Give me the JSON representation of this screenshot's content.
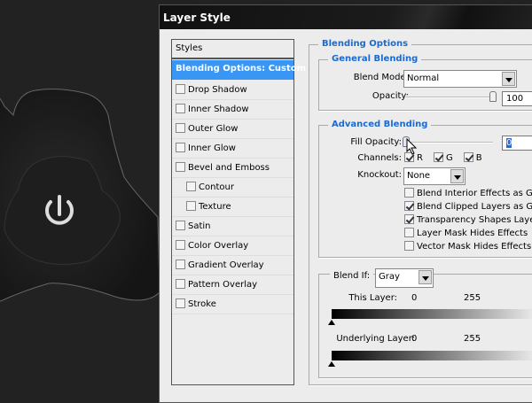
{
  "dialog": {
    "title": "Layer Style"
  },
  "list": {
    "header": "Styles",
    "selected": "Blending Options: Custom",
    "items": [
      {
        "label": "Drop Shadow",
        "checked": false
      },
      {
        "label": "Inner Shadow",
        "checked": false
      },
      {
        "label": "Outer Glow",
        "checked": false
      },
      {
        "label": "Inner Glow",
        "checked": false
      },
      {
        "label": "Bevel and Emboss",
        "checked": false
      },
      {
        "label": "Contour",
        "checked": false
      },
      {
        "label": "Texture",
        "checked": false
      },
      {
        "label": "Satin",
        "checked": false
      },
      {
        "label": "Color Overlay",
        "checked": false
      },
      {
        "label": "Gradient Overlay",
        "checked": false
      },
      {
        "label": "Pattern Overlay",
        "checked": false
      },
      {
        "label": "Stroke",
        "checked": false
      }
    ]
  },
  "blending": {
    "title": "Blending Options",
    "general": {
      "title": "General Blending",
      "blend_mode_label": "Blend Mode:",
      "blend_mode": "Normal",
      "opacity_label": "Opacity:",
      "opacity": "100",
      "opacity_pct": 100
    },
    "advanced": {
      "title": "Advanced Blending",
      "fill_label": "Fill Opacity:",
      "fill": "0",
      "fill_pct": 0,
      "channels_label": "Channels:",
      "channels": [
        "R",
        "G",
        "B"
      ],
      "knockout_label": "Knockout:",
      "knockout": "None",
      "options": [
        {
          "label": "Blend Interior Effects as Group",
          "checked": false
        },
        {
          "label": "Blend Clipped Layers as Group",
          "checked": true
        },
        {
          "label": "Transparency Shapes Layer",
          "checked": true
        },
        {
          "label": "Layer Mask Hides Effects",
          "checked": false
        },
        {
          "label": "Vector Mask Hides Effects",
          "checked": false
        }
      ]
    },
    "blend_if": {
      "label": "Blend If:",
      "value": "Gray",
      "this_layer": "This Layer:",
      "this_min": "0",
      "this_max": "255",
      "underlying": "Underlying Layer:",
      "under_min": "0",
      "under_max": "255"
    }
  }
}
